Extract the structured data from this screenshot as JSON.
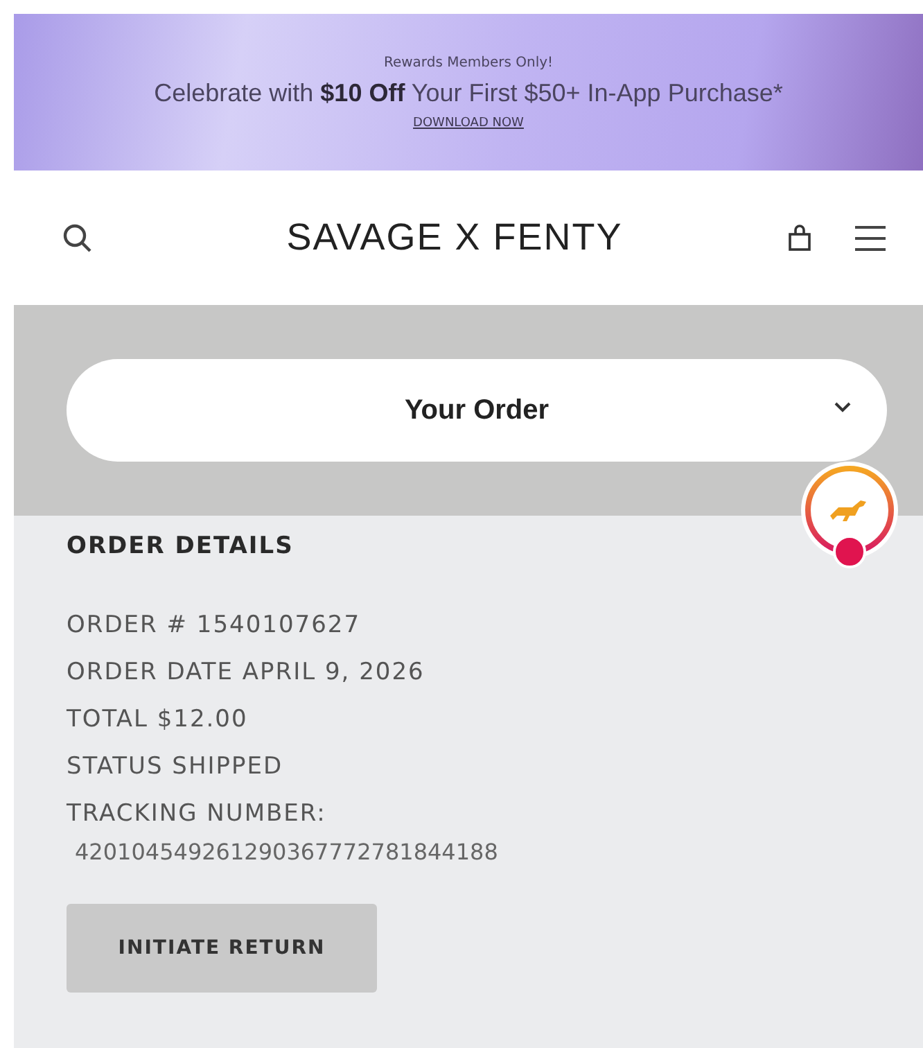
{
  "promo_banner": {
    "eyebrow": "Rewards Members Only!",
    "headline": "Celebrate with **$10 Off** Your First $50+ In-App Purchase*",
    "link": "DOWNLOAD NOW"
  },
  "header": {
    "logo": "SAVAGE X FENTY"
  },
  "order_selector": {
    "label": "Your Order",
    "expanded": false
  },
  "order_details": {
    "heading": "ORDER DETAILS",
    "lines": [
      "ORDER # 1540107627",
      "ORDER DATE APRIL 9, 2026",
      "TOTAL $12.00",
      "STATUS SHIPPED",
      "TRACKING NUMBER:"
    ],
    "tracking_number": "420104549261290367772781844188",
    "button": "INITIATE RETURN"
  }
}
